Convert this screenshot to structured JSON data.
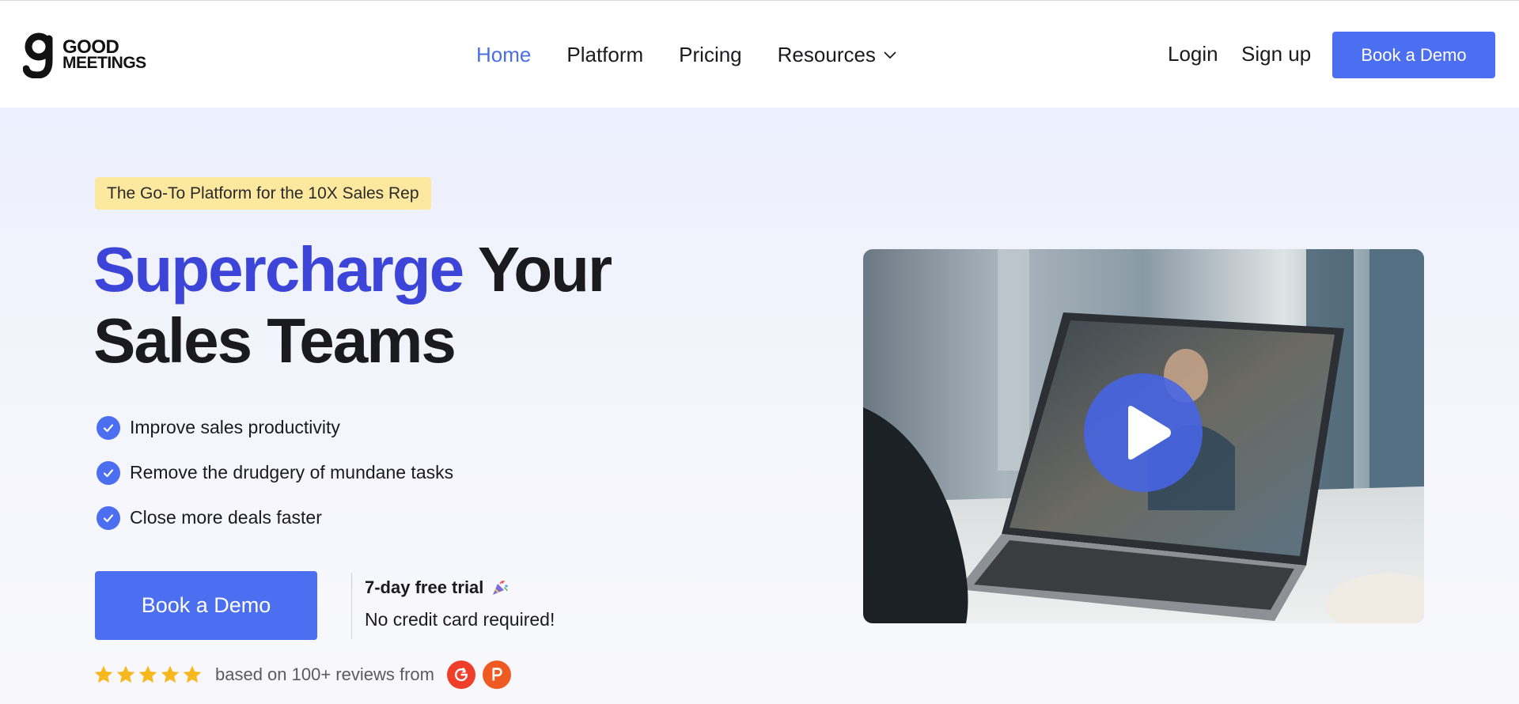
{
  "brand": {
    "line1": "GOOD",
    "line2": "MEETINGS"
  },
  "nav": {
    "items": [
      {
        "label": "Home",
        "active": true
      },
      {
        "label": "Platform",
        "active": false
      },
      {
        "label": "Pricing",
        "active": false
      },
      {
        "label": "Resources",
        "active": false,
        "dropdown": true
      }
    ],
    "login": "Login",
    "signup": "Sign up",
    "cta": "Book a Demo"
  },
  "hero": {
    "tagline": "The Go-To Platform for the 10X Sales Rep",
    "headline_accent": "Supercharge",
    "headline_rest": " Your",
    "headline_line2": "Sales Teams",
    "features": [
      "Improve sales productivity",
      "Remove the drudgery of mundane tasks",
      "Close more deals faster"
    ],
    "cta": "Book a Demo",
    "trial_title": "7-day free trial",
    "trial_icon": "party-popper-icon",
    "trial_sub": "No credit card required!",
    "rating": 5,
    "reviews_text": "based on 100+ reviews from",
    "review_sources": [
      "g2-logo",
      "product-hunt-logo"
    ],
    "video_icon": "play-icon"
  },
  "colors": {
    "accent": "#4c6ef0",
    "headline_accent": "#3d45d9",
    "tagline_bg": "#fde8a0",
    "star": "#f6b81c"
  }
}
